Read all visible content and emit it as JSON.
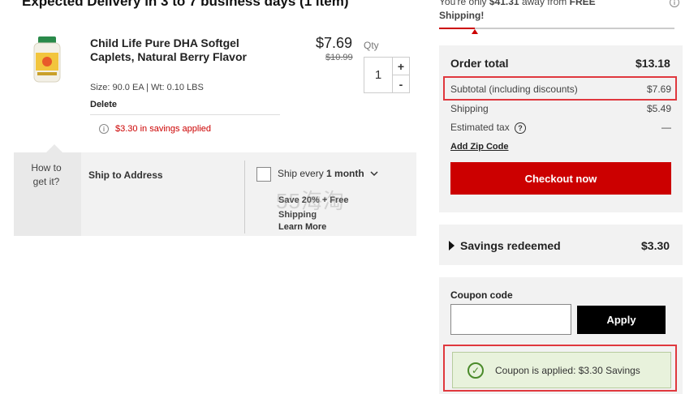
{
  "delivery": {
    "title": "Expected Delivery in 3 to 7 business days (1 item)"
  },
  "product": {
    "name": "Child Life Pure DHA Softgel Caplets, Natural Berry Flavor",
    "price": "$7.69",
    "original_price": "$10.99",
    "qty_label": "Qty",
    "qty_value": "1",
    "plus": "+",
    "minus": "-",
    "size": "Size: 90.0 EA",
    "weight": "Wt: 0.10 LBS",
    "delete_label": "Delete",
    "savings_note": "$3.30 in savings applied"
  },
  "fulfillment": {
    "how_to": "How to get it?",
    "ship_address": "Ship to Address",
    "ship_every_prefix": "Ship every ",
    "ship_every_value": "1 month",
    "save_text": "Save 20% + Free Shipping",
    "learn_more": "Learn More"
  },
  "free_shipping": {
    "prefix": "You're only ",
    "amount": "$41.31",
    "middle": " away from ",
    "strong": "FREE Shipping!",
    "progress_fraction": 0.15
  },
  "order": {
    "title": "Order total",
    "total": "$13.18",
    "rows": [
      {
        "label": "Subtotal (including discounts)",
        "value": "$7.69"
      },
      {
        "label": "Shipping",
        "value": "$5.49"
      },
      {
        "label": "Estimated tax",
        "value": "—"
      }
    ],
    "zip_link": "Add Zip Code",
    "checkout": "Checkout now"
  },
  "savings": {
    "label": "Savings redeemed",
    "value": "$3.30"
  },
  "coupon": {
    "label": "Coupon code",
    "placeholder": "",
    "apply": "Apply",
    "applied_message": "Coupon is applied: $3.30 Savings"
  },
  "watermark": "55海淘",
  "colors": {
    "brand_red": "#cc0000",
    "highlight_red": "#e0383e",
    "success_green": "#4a8a2a"
  }
}
